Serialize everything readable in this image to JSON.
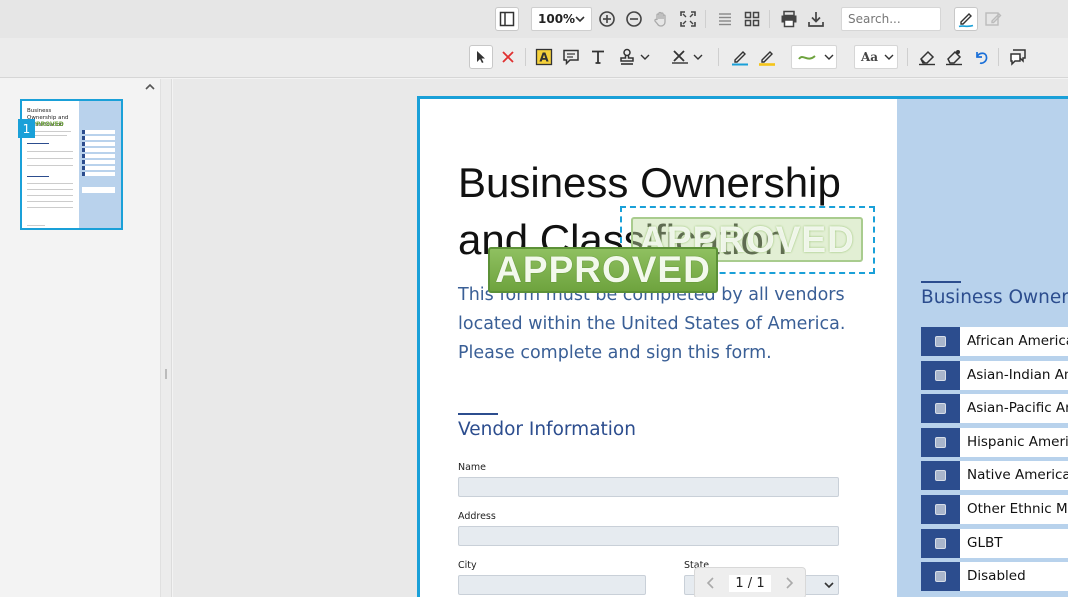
{
  "toolbar": {
    "zoom": "100%",
    "search_placeholder": "Search..."
  },
  "thumbnail": {
    "page_number": "1",
    "title": "Business Ownership and Classification",
    "stamp": "APPROVED"
  },
  "document": {
    "title": "Business Ownership and Classification",
    "intro": "This form must be completed by all vendors located within the United States of America. Please complete and sign this form.",
    "vendor_heading": "Vendor Information",
    "fields": {
      "name": "Name",
      "address": "Address",
      "city": "City",
      "state": "State"
    },
    "ownership_heading": "Business Owner",
    "ownership_items": [
      "African America",
      "Asian-Indian Am",
      "Asian-Pacific Ar",
      "Hispanic Americ",
      "Native American",
      "Other Ethnic Mi",
      "GLBT",
      "Disabled"
    ],
    "stamps": {
      "primary": "APPROVED",
      "secondary": "APPROVED"
    }
  },
  "page_nav": {
    "indicator": "1 / 1"
  },
  "colors": {
    "accent": "#1aa0d8",
    "brand_blue": "#2c4d8e",
    "stamp_green": "#6ea33e",
    "sidebar_blue": "#b8d2ec"
  }
}
